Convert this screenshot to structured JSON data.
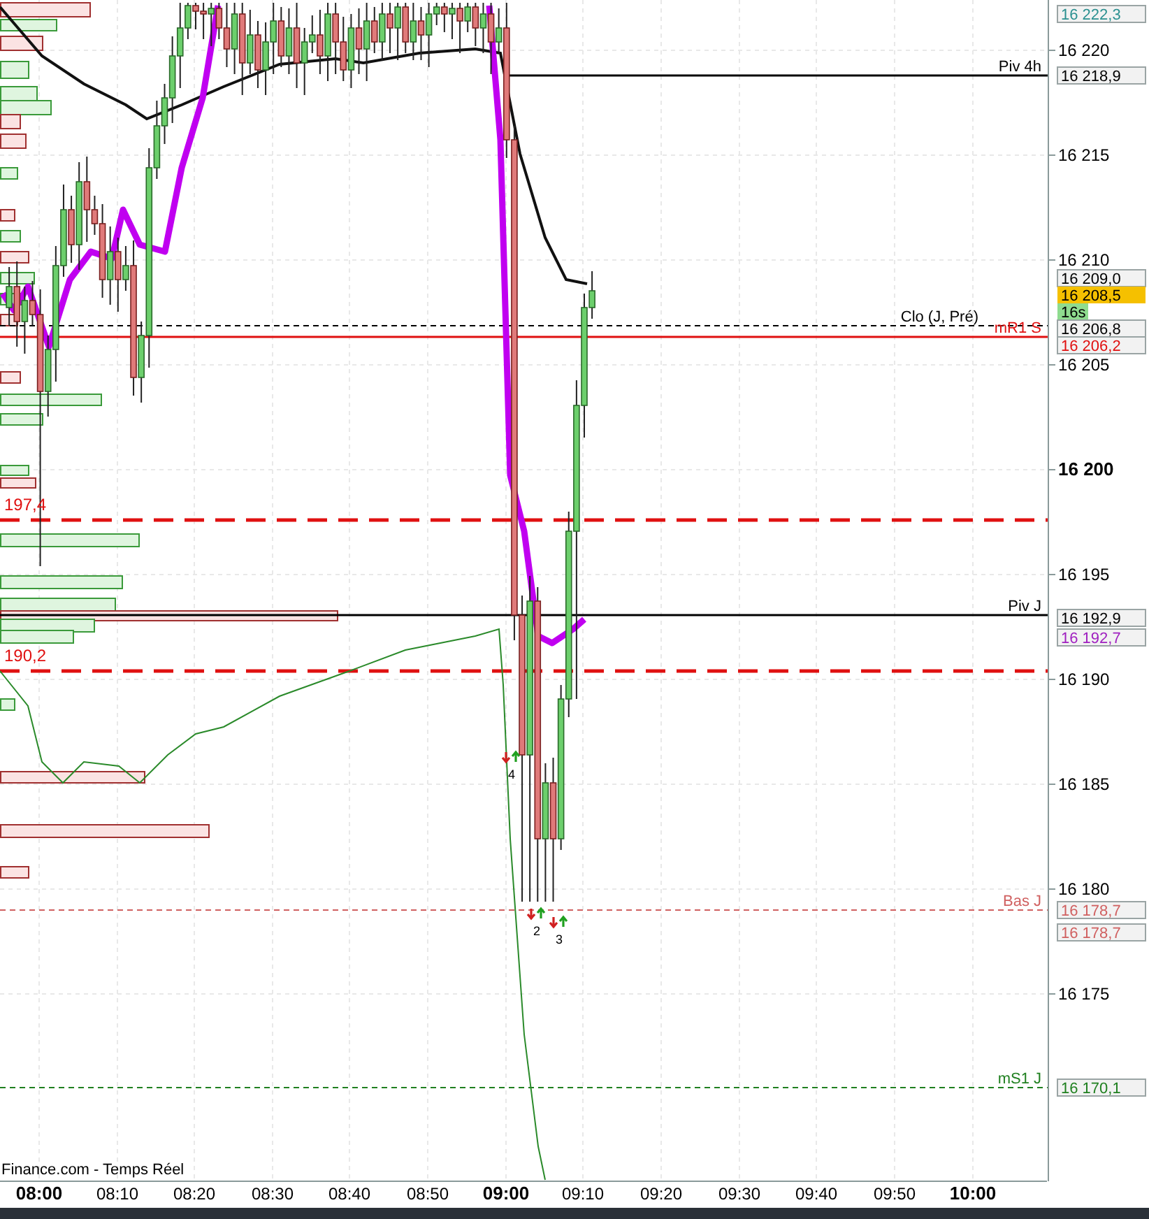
{
  "chart": {
    "source": "Finance.com - Temps Réel",
    "price_ticks": [
      {
        "label": "16 220",
        "bold": false
      },
      {
        "label": "16 215",
        "bold": false
      },
      {
        "label": "16 210",
        "bold": false
      },
      {
        "label": "16 205",
        "bold": false
      },
      {
        "label": "16 200",
        "bold": true
      },
      {
        "label": "16 195",
        "bold": false
      },
      {
        "label": "16 190",
        "bold": false
      },
      {
        "label": "16 185",
        "bold": false
      },
      {
        "label": "16 180",
        "bold": false
      },
      {
        "label": "16 175",
        "bold": false
      }
    ],
    "time_ticks": [
      {
        "label": "08:00",
        "bold": true
      },
      {
        "label": "08:10",
        "bold": false
      },
      {
        "label": "08:20",
        "bold": false
      },
      {
        "label": "08:30",
        "bold": false
      },
      {
        "label": "08:40",
        "bold": false
      },
      {
        "label": "08:50",
        "bold": false
      },
      {
        "label": "09:00",
        "bold": true
      },
      {
        "label": "09:10",
        "bold": false
      },
      {
        "label": "09:20",
        "bold": false
      },
      {
        "label": "09:30",
        "bold": false
      },
      {
        "label": "09:40",
        "bold": false
      },
      {
        "label": "09:50",
        "bold": false
      },
      {
        "label": "10:00",
        "bold": true
      }
    ],
    "levels": [
      {
        "label": "Piv 4h",
        "color": "#000000"
      },
      {
        "label": "Clo (J, Pré)",
        "color": "#000000"
      },
      {
        "label": "mR1 S",
        "color": "#e01010"
      },
      {
        "side_label": "197,4",
        "color": "#e01010"
      },
      {
        "side_label": "190,2",
        "color": "#e01010"
      },
      {
        "label": "Piv J",
        "color": "#000000"
      },
      {
        "label": "Bas J",
        "color": "#d06060"
      },
      {
        "label": "mS1 J",
        "color": "#208020"
      }
    ],
    "price_tags": [
      {
        "text": "16 222,3",
        "color": "#2a9090",
        "kind": "plain"
      },
      {
        "text": "16 218,9",
        "color": "#000000",
        "kind": "plain"
      },
      {
        "text": "16 209,0",
        "color": "#000000",
        "kind": "plain"
      },
      {
        "text": "16 208,5",
        "color": "#000000",
        "kind": "highlight"
      },
      {
        "text": "16s",
        "color": "#000000",
        "kind": "timer"
      },
      {
        "text": "16 206,8",
        "color": "#000000",
        "kind": "plain"
      },
      {
        "text": "16 206,2",
        "color": "#e01010",
        "kind": "plain"
      },
      {
        "text": "16 192,9",
        "color": "#000000",
        "kind": "plain"
      },
      {
        "text": "16 192,7",
        "color": "#a020c0",
        "kind": "plain"
      },
      {
        "text": "16 178,7",
        "color": "#d06060",
        "kind": "plain"
      },
      {
        "text": "16 178,7",
        "color": "#d06060",
        "kind": "plain"
      },
      {
        "text": "16 170,1",
        "color": "#208020",
        "kind": "plain"
      }
    ],
    "signals": [
      {
        "label": "4"
      },
      {
        "label": "2"
      },
      {
        "label": "3"
      }
    ]
  }
}
